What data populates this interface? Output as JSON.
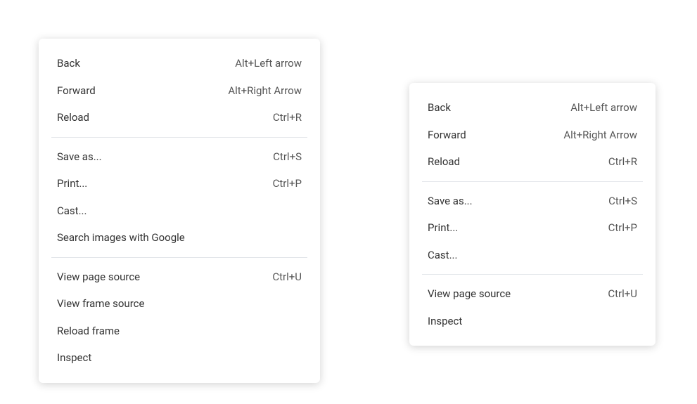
{
  "menus": {
    "left": {
      "groups": [
        [
          {
            "label": "Back",
            "shortcut": "Alt+Left arrow"
          },
          {
            "label": "Forward",
            "shortcut": "Alt+Right Arrow"
          },
          {
            "label": "Reload",
            "shortcut": "Ctrl+R"
          }
        ],
        [
          {
            "label": "Save as...",
            "shortcut": "Ctrl+S"
          },
          {
            "label": "Print...",
            "shortcut": "Ctrl+P"
          },
          {
            "label": "Cast...",
            "shortcut": ""
          },
          {
            "label": "Search images with Google",
            "shortcut": ""
          }
        ],
        [
          {
            "label": "View page source",
            "shortcut": "Ctrl+U"
          },
          {
            "label": "View frame source",
            "shortcut": ""
          },
          {
            "label": "Reload frame",
            "shortcut": ""
          },
          {
            "label": "Inspect",
            "shortcut": ""
          }
        ]
      ]
    },
    "right": {
      "groups": [
        [
          {
            "label": "Back",
            "shortcut": "Alt+Left arrow"
          },
          {
            "label": "Forward",
            "shortcut": "Alt+Right Arrow"
          },
          {
            "label": "Reload",
            "shortcut": "Ctrl+R"
          }
        ],
        [
          {
            "label": "Save as...",
            "shortcut": "Ctrl+S"
          },
          {
            "label": "Print...",
            "shortcut": "Ctrl+P"
          },
          {
            "label": "Cast...",
            "shortcut": ""
          }
        ],
        [
          {
            "label": "View page source",
            "shortcut": "Ctrl+U"
          },
          {
            "label": "Inspect",
            "shortcut": ""
          }
        ]
      ]
    }
  }
}
